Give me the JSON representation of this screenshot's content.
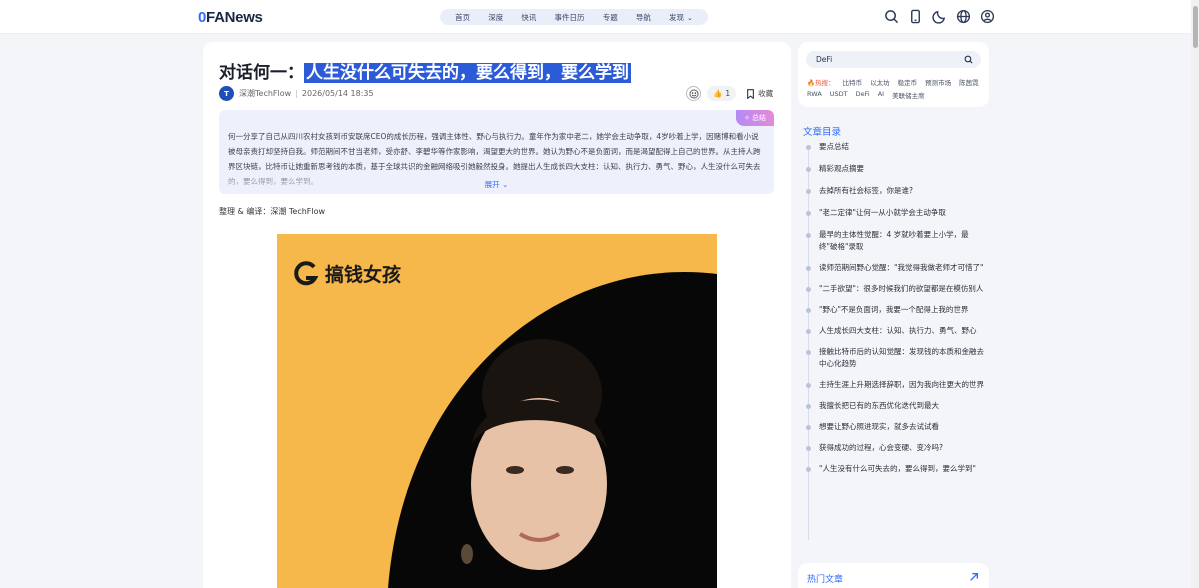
{
  "header": {
    "logo_mark": "0",
    "logo_text": "FANews",
    "nav": [
      {
        "label": "首页"
      },
      {
        "label": "深度"
      },
      {
        "label": "快讯"
      },
      {
        "label": "事件日历"
      },
      {
        "label": "专题"
      },
      {
        "label": "导航"
      },
      {
        "label": "发现"
      }
    ],
    "icons": [
      "search-icon",
      "mobile-icon",
      "moon-icon",
      "globe-icon",
      "user-icon"
    ]
  },
  "article": {
    "title_prefix": "对话何一：",
    "title_highlight": "人生没什么可失去的，要么得到，要么学到",
    "author": "深潮TechFlow",
    "date": "2026/05/14 18:35",
    "like_count": "1",
    "favorite_label": "收藏",
    "summary_badge": "总结",
    "summary_text": "何一分享了自己从四川农村女孩到币安联席CEO的成长历程，强调主体性、野心与执行力。童年作为家中老二，她学会主动争取，4岁吵着上学，因赌博和看小说被母亲责打却坚持自我。师范期间不甘当老师，受亦舒、李碧华等作家影响，渴望更大的世界。她认为野心不是负面词，而是渴望配得上自己的世界。从主持人跨界区块链，比特币让她重新思考钱的本质，基于全球共识的金融网络吸引她毅然投身。她提出人生成长四大支柱：认知、执行力、勇气、野心，人生没什么可失去的，要么得到，要么学到。",
    "expand_label": "展开",
    "credit": "整理 & 编译：深潮 TechFlow",
    "cover_brand": "搞钱女孩"
  },
  "sidebar": {
    "search_value": "DeFi",
    "hot_label": "热搜：",
    "hot_row1": [
      "比特币",
      "以太坊",
      "稳定币",
      "预测市场",
      "陈茜霓"
    ],
    "hot_row2": [
      "RWA",
      "USDT",
      "DeFi",
      "AI",
      "美联储主席"
    ],
    "toc_title": "文章目录",
    "toc": [
      "要点总结",
      "精彩观点摘要",
      "去掉所有社会标签，你是谁?",
      "\"老二定律\"让何一从小就学会主动争取",
      "最早的主体性觉醒：4 岁就吵着要上小学，最终\"破格\"录取",
      "读师范期间野心觉醒：\"我觉得我做老师才可惜了\"",
      "\"二手欲望\"：很多时候我们的欲望都是在模仿别人",
      "\"野心\"不是负面词，我要一个配得上我的世界",
      "人生成长四大支柱：认知、执行力、勇气、野心",
      "接触比特币后的认知觉醒：发现钱的本质和金融去中心化趋势",
      "主持生涯上升期选择辞职，因为我向往更大的世界",
      "我擅长把已有的东西优化迭代到最大",
      "想要让野心照进现实，就多去试试看",
      "获得成功的过程，心会变硬、变冷吗?",
      "\"人生没有什么可失去的，要么得到，要么学到\""
    ],
    "hot_articles_title": "热门文章"
  },
  "colors": {
    "accent": "#2f6bff",
    "highlight": "#2b5bd7",
    "cover_bg": "#f6b74b"
  }
}
